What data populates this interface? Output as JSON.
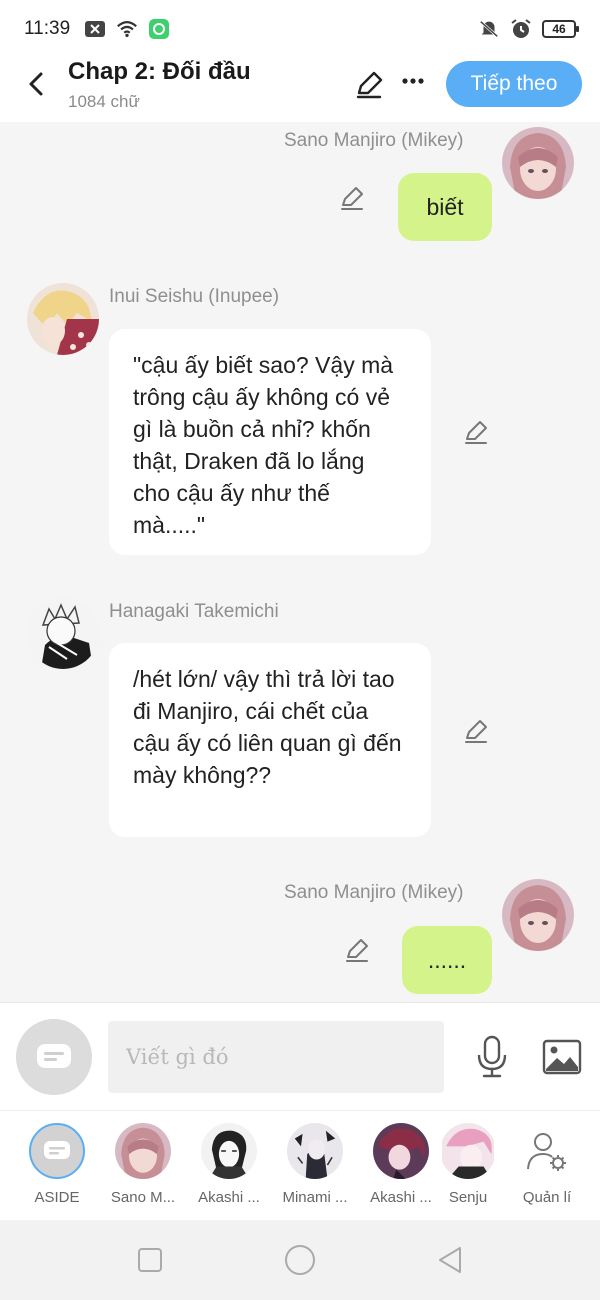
{
  "status_bar": {
    "time": "11:39",
    "battery": "46"
  },
  "header": {
    "title": "Chap 2: Đối đầu",
    "word_count": "1084 chữ",
    "next_label": "Tiếp theo"
  },
  "messages": [
    {
      "speaker": "Sano Manjiro (Mikey)",
      "side": "right",
      "text": "biết"
    },
    {
      "speaker": "Inui Seishu (Inupee)",
      "side": "left",
      "text": "\"cậu ấy biết sao? Vậy mà trông cậu ấy không có vẻ gì là buồn cả nhỉ? khốn thật, Draken đã lo lắng cho cậu ấy như thế mà.....\""
    },
    {
      "speaker": "Hanagaki Takemichi",
      "side": "left",
      "text": "/hét lớn/ vậy thì trả lời tao đi Manjiro, cái chết của cậu ấy có liên quan gì đến mày không??"
    },
    {
      "speaker": "Sano Manjiro (Mikey)",
      "side": "right",
      "text": "......"
    }
  ],
  "composer": {
    "placeholder": "Viết gì đó"
  },
  "characters": [
    {
      "label": "ASIDE"
    },
    {
      "label": "Sano M..."
    },
    {
      "label": "Akashi ..."
    },
    {
      "label": "Minami ..."
    },
    {
      "label": "Akashi ..."
    },
    {
      "label": "Senju"
    },
    {
      "label": "Quản lí"
    }
  ],
  "colors": {
    "accent": "#5aaef5",
    "bubble_self": "#d4f38a",
    "bubble_other": "#ffffff"
  }
}
